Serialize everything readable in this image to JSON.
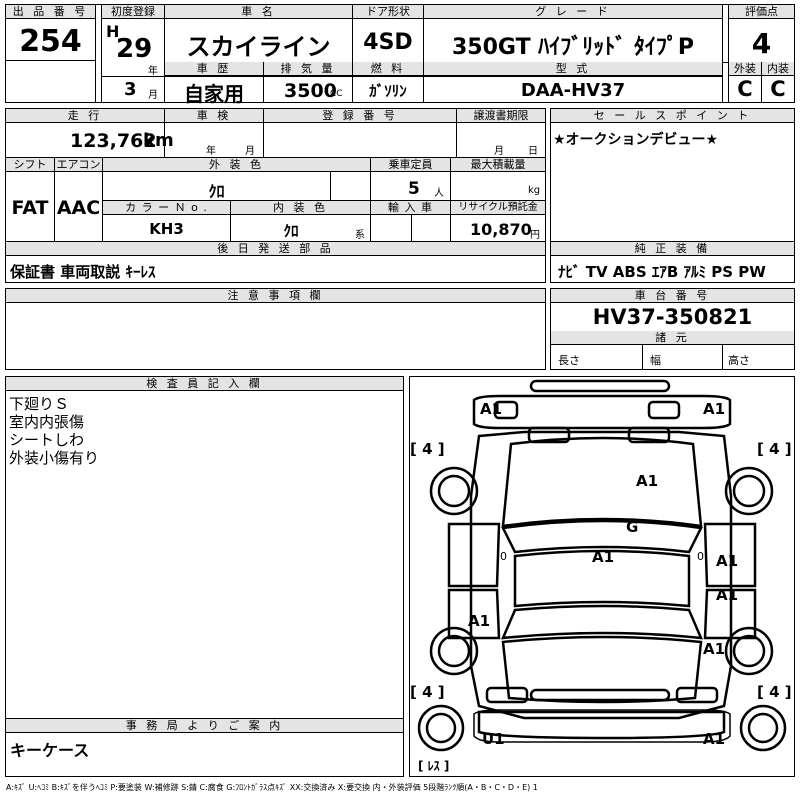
{
  "top": {
    "lot_no_label": "出 品 番 号",
    "lot_no": "254",
    "first_reg_label": "初度登録",
    "era": "H",
    "year": "29",
    "year_unit": "年",
    "month": "3",
    "month_unit": "月",
    "car_name_label": "車 名",
    "car_name": "スカイライン",
    "history_label": "車 歴",
    "history": "自家用",
    "displacement_label": "排 気 量",
    "displacement": "3500",
    "displacement_unit": "CC",
    "door_label": "ドア形状",
    "door": "4SD",
    "fuel_label": "燃 料",
    "fuel": "ｶﾞｿﾘﾝ",
    "grade_label": "グ レ ー ド",
    "grade": "350GT ﾊｲﾌﾞﾘｯﾄﾞ ﾀｲﾌﾟP",
    "model_label": "型 式",
    "model": "DAA-HV37",
    "score_label": "評価点",
    "score": "4",
    "exterior_label": "外装",
    "exterior": "C",
    "interior_label": "内装",
    "interior": "C"
  },
  "mid": {
    "mileage_label": "走 行",
    "mileage": "123,762",
    "mileage_unit": "km",
    "inspection_label": "車 検",
    "insp_year_unit": "年",
    "insp_month_unit": "月",
    "reg_no_label": "登 録 番 号",
    "transfer_label": "譲渡書期限",
    "transfer_month_unit": "月",
    "transfer_day_unit": "日",
    "shift_label": "シフト",
    "shift": "FAT",
    "ac_label": "エアコン",
    "ac": "AAC",
    "ext_color_label": "外 装 色",
    "ext_color": "ｸﾛ",
    "color_no_label": "カ ラ ー Ｎ o .",
    "color_no": "KH3",
    "int_color_label": "内 装 色",
    "int_color": "ｸﾛ",
    "int_color_unit": "系",
    "capacity_label": "乗車定員",
    "capacity": "5",
    "capacity_unit": "人",
    "load_label": "最大積載量",
    "load_unit": "kg",
    "import_label": "輸 入 車",
    "recycle_label": "リサイクル預託金",
    "recycle": "10,870",
    "recycle_unit": "円",
    "later_label": "後 日 発 送 部 品",
    "later": "保証書 車両取説 ｷｰﾚｽ"
  },
  "sales": {
    "label": "セ ー ル ス ポ イ ン ト",
    "text": "★オークションデビュー★"
  },
  "equipment": {
    "label": "純 正 装 備",
    "text": "ﾅﾋﾞ  TV  ABS ｴｱB ｱﾙﾐ PS PW"
  },
  "notes": {
    "label": "注 意 事 項 欄"
  },
  "chassis": {
    "label": "車 台 番 号",
    "number": "HV37-350821"
  },
  "specs": {
    "label": "諸 元",
    "length": "長さ",
    "width": "幅",
    "height": "高さ"
  },
  "inspector": {
    "label": "検 査 員 記 入 欄",
    "lines": [
      "下廻りＳ",
      "室内内張傷",
      "シートしわ",
      "外装小傷有り"
    ]
  },
  "office": {
    "label": "事 務 局 よ り ご 案 内",
    "text": "キーケース"
  },
  "diagram": {
    "marks": {
      "front_left": "A1",
      "front_right": "A1",
      "hood": "A1",
      "windshield": "G",
      "roof": "A1",
      "right_front_door": "A1",
      "right_rear_door": "A1",
      "left_rear_door": "A1",
      "right_rear_fender": "A1",
      "rear_left": "U1",
      "rear_right": "A1"
    },
    "tires": {
      "fl": "4",
      "fr": "4",
      "rl": "4",
      "rr": "4"
    },
    "tire_bracket_open": "[",
    "tire_bracket_close": "]",
    "zero": "0",
    "spare_open": "[",
    "spare": "ﾚｽ",
    "spare_close": "]"
  },
  "legend": "A:ｷｽﾞ U:ﾍｺﾐ B:ｷｽﾞを伴うﾍｺﾐ P:要塗装 W:補修跡 S:錆 C:腐食 G:ﾌﾛﾝﾄｶﾞﾗｽ点ｷｽﾞ XX:交換済み X:要交換 内・外装評価 5段階ﾗﾝｸ順(A・B・C・D・E) 1"
}
